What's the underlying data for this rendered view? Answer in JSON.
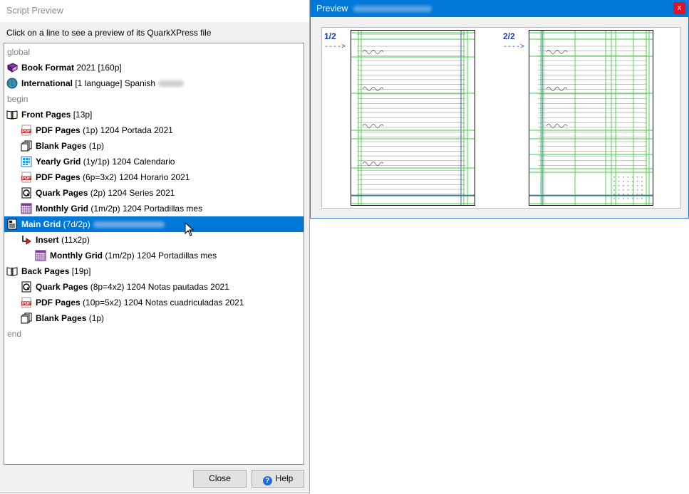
{
  "script_window": {
    "title": "Script Preview",
    "instruction": "Click on a line to see a preview of its QuarkXPress file",
    "items": [
      {
        "type": "keyword",
        "label": "global"
      },
      {
        "type": "item",
        "indent": 0,
        "icon": "book-icon",
        "bold": "Book Format",
        "rest": " 2021 [160p]"
      },
      {
        "type": "item",
        "indent": 0,
        "icon": "globe-icon",
        "bold": "International",
        "rest": " [1 language] Spanish",
        "blur": true
      },
      {
        "type": "keyword",
        "label": "begin"
      },
      {
        "type": "item",
        "indent": 0,
        "icon": "open-book-icon",
        "bold": "Front Pages",
        "rest": " [13p]"
      },
      {
        "type": "item",
        "indent": 1,
        "icon": "pdf-icon",
        "bold": "PDF Pages",
        "rest": " (1p) 1204 Portada 2021"
      },
      {
        "type": "item",
        "indent": 1,
        "icon": "blank-pages-icon",
        "bold": "Blank Pages",
        "rest": " (1p)"
      },
      {
        "type": "item",
        "indent": 1,
        "icon": "yearly-grid-icon",
        "bold": "Yearly Grid",
        "rest": " (1y/1p) 1204 Calendario"
      },
      {
        "type": "item",
        "indent": 1,
        "icon": "pdf-icon",
        "bold": "PDF Pages",
        "rest": " (6p=3x2) 1204 Horario 2021"
      },
      {
        "type": "item",
        "indent": 1,
        "icon": "quark-icon",
        "bold": "Quark Pages",
        "rest": " (2p) 1204 Series 2021"
      },
      {
        "type": "item",
        "indent": 1,
        "icon": "monthly-grid-icon",
        "bold": "Monthly Grid",
        "rest": " (1m/2p) 1204 Portadillas mes"
      },
      {
        "type": "item",
        "indent": 0,
        "icon": "main-grid-icon",
        "bold": "Main Grid",
        "rest": " (7d/2p)",
        "blur": true,
        "selected": true
      },
      {
        "type": "item",
        "indent": 1,
        "icon": "insert-arrow-icon",
        "bold": "Insert",
        "rest": " (11x2p)"
      },
      {
        "type": "item",
        "indent": 2,
        "icon": "monthly-grid-icon",
        "bold": "Monthly Grid",
        "rest": " (1m/2p) 1204 Portadillas mes"
      },
      {
        "type": "item",
        "indent": 0,
        "icon": "open-book-icon",
        "bold": "Back Pages",
        "rest": " [19p]"
      },
      {
        "type": "item",
        "indent": 1,
        "icon": "quark-icon",
        "bold": "Quark Pages",
        "rest": " (8p=4x2) 1204 Notas pautadas 2021"
      },
      {
        "type": "item",
        "indent": 1,
        "icon": "pdf-icon",
        "bold": "PDF Pages",
        "rest": " (10p=5x2) 1204 Notas cuadriculadas 2021"
      },
      {
        "type": "item",
        "indent": 1,
        "icon": "blank-pages-icon",
        "bold": "Blank Pages",
        "rest": " (1p)"
      },
      {
        "type": "keyword",
        "label": "end"
      }
    ],
    "close_label": "Close",
    "help_label": "Help",
    "help_icon": "?"
  },
  "preview_window": {
    "title": "Preview",
    "close_icon": "x",
    "spreads": [
      {
        "label": "1/2",
        "arrow": "---->"
      },
      {
        "label": "2/2",
        "arrow": "---->"
      }
    ]
  },
  "colors": {
    "selection": "#0078d7",
    "guide_green": "#3ccf3c",
    "guide_blue": "#2a36c8",
    "spread_label": "#1a3fb0"
  }
}
